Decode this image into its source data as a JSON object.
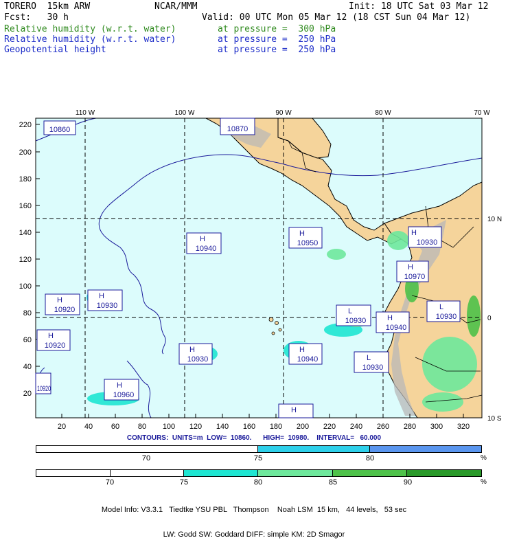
{
  "header": {
    "model": "TORERO  15km ARW",
    "center": "NCAR/MMM",
    "init": "Init: 18 UTC Sat 03 Mar 12",
    "fcst": "Fcst:   30 h",
    "valid": "Valid: 00 UTC Mon 05 Mar 12 (18 CST Sun 04 Mar 12)",
    "fields": [
      {
        "name": "Relative humidity (w.r.t. water)",
        "level": "at pressure =  300 hPa",
        "color": "#2f8a1e"
      },
      {
        "name": "Relative humidity (w.r.t. water)",
        "level": "at pressure =  250 hPa",
        "color": "#1c2cc8"
      },
      {
        "name": "Geopotential height",
        "level": "at pressure =  250 hPa",
        "color": "#1c2cc8"
      }
    ]
  },
  "map": {
    "lon_labels": [
      "110 W",
      "100 W",
      "90 W",
      "80 W",
      "70 W"
    ],
    "lat_labels": [
      "10 N",
      "0",
      "10 S"
    ],
    "y_ticks": [
      "220",
      "200",
      "180",
      "160",
      "140",
      "120",
      "100",
      "80",
      "60",
      "40",
      "20"
    ],
    "x_ticks": [
      "20",
      "40",
      "60",
      "80",
      "100",
      "120",
      "140",
      "160",
      "180",
      "200",
      "220",
      "240",
      "260",
      "280",
      "300",
      "320"
    ],
    "centers": [
      {
        "type": "L",
        "value": "10860"
      },
      {
        "type": "L",
        "value": "10870"
      },
      {
        "type": "H",
        "value": "10940"
      },
      {
        "type": "H",
        "value": "10950"
      },
      {
        "type": "H",
        "value": "10930"
      },
      {
        "type": "H",
        "value": "10970"
      },
      {
        "type": "H",
        "value": "10920"
      },
      {
        "type": "H",
        "value": "10930"
      },
      {
        "type": "L",
        "value": "10930"
      },
      {
        "type": "H",
        "value": "10940"
      },
      {
        "type": "L",
        "value": "10930"
      },
      {
        "type": "H",
        "value": "10920"
      },
      {
        "type": "H",
        "value": "10930"
      },
      {
        "type": "H",
        "value": "10940"
      },
      {
        "type": "L",
        "value": "10930"
      },
      {
        "type": "H",
        "value": "10960"
      },
      {
        "type": "H",
        "value": "10920"
      },
      {
        "type": "H",
        "value": "10950"
      }
    ],
    "colors": {
      "ocean": "#dcfcfc",
      "land": "#f5d49b",
      "mountain": "#b8b8b8",
      "coast": "#000000",
      "contour": "#1a1a9a"
    }
  },
  "contours_text": "CONTOURS:  UNITS=m  LOW=  10860.      HIGH=  10980.    INTERVAL=   60.000",
  "colorbar_250": {
    "segments": [
      {
        "label": "",
        "color": "#ffffff"
      },
      {
        "label": "75",
        "color": "#2ed0ea"
      },
      {
        "label": "80",
        "color": "#5a96ef"
      }
    ],
    "tick_labels": [
      "70",
      "75",
      "80"
    ],
    "unit": "%"
  },
  "colorbar_300": {
    "segments": [
      {
        "label": "",
        "color": "#ffffff"
      },
      {
        "label": "",
        "color": "#ffffff"
      },
      {
        "label": "75",
        "color": "#1ee6d2"
      },
      {
        "label": "80",
        "color": "#6ee89c"
      },
      {
        "label": "85",
        "color": "#4ec24a"
      },
      {
        "label": "90",
        "color": "#2a9a2a"
      }
    ],
    "tick_labels": [
      "70",
      "75",
      "80",
      "85",
      "90"
    ],
    "unit": "%"
  },
  "model_info": [
    "Model Info: V3.3.1   Tiedtke YSU PBL   Thompson    Noah LSM  15 km,   44 levels,   53 sec",
    "LW: Godd SW: Goddard DIFF: simple KM: 2D Smagor"
  ]
}
